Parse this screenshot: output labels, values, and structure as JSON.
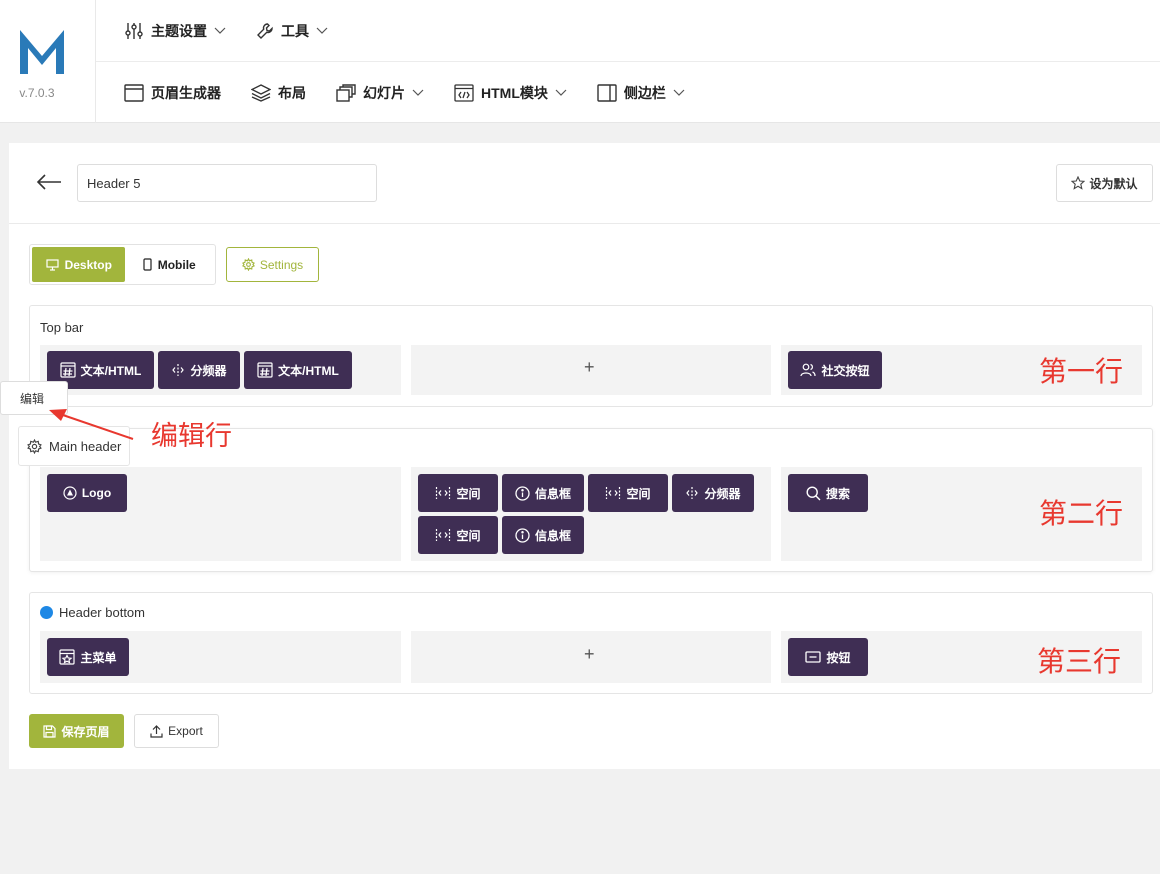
{
  "app": {
    "version": "v.7.0.3"
  },
  "nav_row1": [
    {
      "label": "主题设置",
      "icon": "sliders-icon"
    },
    {
      "label": "工具",
      "icon": "wrench-icon"
    }
  ],
  "nav_row2": [
    {
      "label": "页眉生成器",
      "icon": "window-icon"
    },
    {
      "label": "布局",
      "icon": "layers-icon"
    },
    {
      "label": "幻灯片",
      "icon": "slides-icon"
    },
    {
      "label": "HTML模块",
      "icon": "code-icon"
    },
    {
      "label": "侧边栏",
      "icon": "sidebar-icon"
    }
  ],
  "editor": {
    "header_name": "Header 5",
    "set_default": "设为默认",
    "desktop": "Desktop",
    "mobile": "Mobile",
    "settings": "Settings",
    "save": "保存页眉",
    "export": "Export"
  },
  "rows": {
    "top_bar": {
      "label": "Top bar",
      "left": [
        "文本/HTML",
        "分频器",
        "文本/HTML"
      ],
      "center_plus": "+",
      "right": [
        "社交按钮"
      ]
    },
    "main_header": {
      "label": "Main header",
      "left": [
        "Logo"
      ],
      "center": [
        "空间",
        "信息框",
        "空间",
        "分频器",
        "空间",
        "信息框"
      ],
      "right": [
        "搜索"
      ]
    },
    "header_bottom": {
      "label": "Header bottom",
      "left": [
        "主菜单"
      ],
      "center_plus": "+",
      "right": [
        "按钮"
      ]
    }
  },
  "annotations": {
    "tooltip": "编辑",
    "edit_row": "编辑行",
    "row1": "第一行",
    "row2": "第二行",
    "row3": "第三行"
  },
  "colors": {
    "accent": "#a2b53c",
    "chip": "#3f2e54",
    "annotation": "#e8382f",
    "dot": "#1e88e5"
  }
}
